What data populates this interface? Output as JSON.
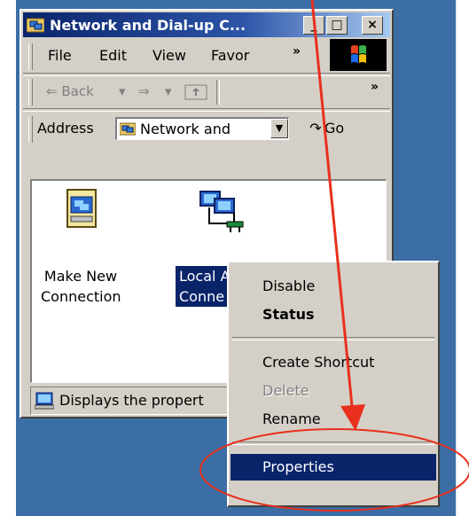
{
  "window": {
    "title": "Network and Dial-up C...",
    "controls": {
      "minimize": "_",
      "maximize": "□",
      "close": "×"
    }
  },
  "menubar": {
    "items": [
      "File",
      "Edit",
      "View",
      "Favor"
    ],
    "more": "»"
  },
  "toolbar": {
    "back_label": "Back",
    "more": "»"
  },
  "address_bar": {
    "label": "Address",
    "value": "Network and",
    "go_label": "Go"
  },
  "content": {
    "items": [
      {
        "label_line1": "Make New",
        "label_line2": "Connection",
        "icon": "make-new-connection-icon",
        "selected": false
      },
      {
        "label_line1": "Local Area",
        "label_line2": "Conne",
        "icon": "local-area-connection-icon",
        "selected": true
      }
    ]
  },
  "status_bar": {
    "text": "Displays the propert"
  },
  "context_menu": {
    "items": [
      {
        "label": "Disable",
        "style": "normal"
      },
      {
        "label": "Status",
        "style": "bold"
      },
      {
        "label": "Create Shortcut",
        "style": "normal"
      },
      {
        "label": "Delete",
        "style": "disabled"
      },
      {
        "label": "Rename",
        "style": "normal"
      },
      {
        "label": "Properties",
        "style": "highlight"
      }
    ]
  },
  "colors": {
    "desktop": "#3a6ea5",
    "titlebar": "#0a246a",
    "selection": "#0a246a",
    "annotation": "#e8301c"
  }
}
